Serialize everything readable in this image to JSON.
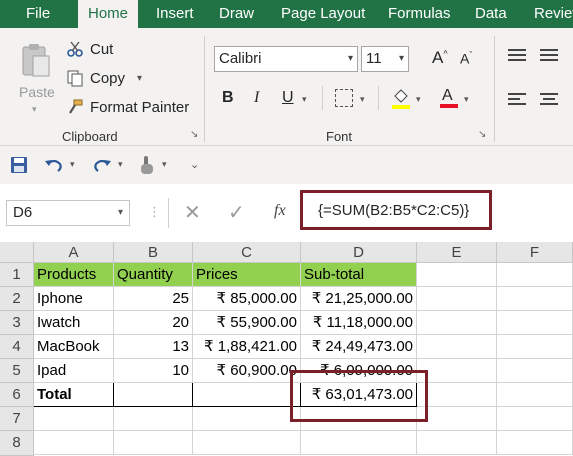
{
  "tabs": [
    "File",
    "Home",
    "Insert",
    "Draw",
    "Page Layout",
    "Formulas",
    "Data",
    "Review"
  ],
  "active_tab": "Home",
  "clipboard": {
    "paste_label": "Paste",
    "cut_label": "Cut",
    "copy_label": "Copy",
    "format_painter_label": "Format Painter",
    "group_label": "Clipboard"
  },
  "font": {
    "name": "Calibri",
    "size": "11",
    "group_label": "Font",
    "bold": "B",
    "italic": "I",
    "underline": "U",
    "grow": "A",
    "shrink": "A"
  },
  "formula_bar": {
    "name_box": "D6",
    "fx": "fx",
    "formula": "{=SUM(B2:B5*C2:C5)}"
  },
  "columns": [
    "A",
    "B",
    "C",
    "D",
    "E",
    "F"
  ],
  "rows": [
    "1",
    "2",
    "3",
    "4",
    "5",
    "6",
    "7",
    "8"
  ],
  "table": {
    "headers": [
      "Products",
      "Quantity",
      "Prices",
      "Sub-total"
    ],
    "data": [
      [
        "Iphone",
        "25",
        "₹ 85,000.00",
        "₹ 21,25,000.00"
      ],
      [
        "Iwatch",
        "20",
        "₹ 55,900.00",
        "₹ 11,18,000.00"
      ],
      [
        "MacBook",
        "13",
        "₹ 1,88,421.00",
        "₹ 24,49,473.00"
      ],
      [
        "Ipad",
        "10",
        "₹ 60,900.00",
        "₹ 6,09,000.00"
      ]
    ],
    "total_label": "Total",
    "total_value": "₹ 63,01,473.00"
  },
  "colors": {
    "ribbon_green": "#217346",
    "header_fill": "#92d050",
    "highlight_box": "#7b1f2b"
  }
}
